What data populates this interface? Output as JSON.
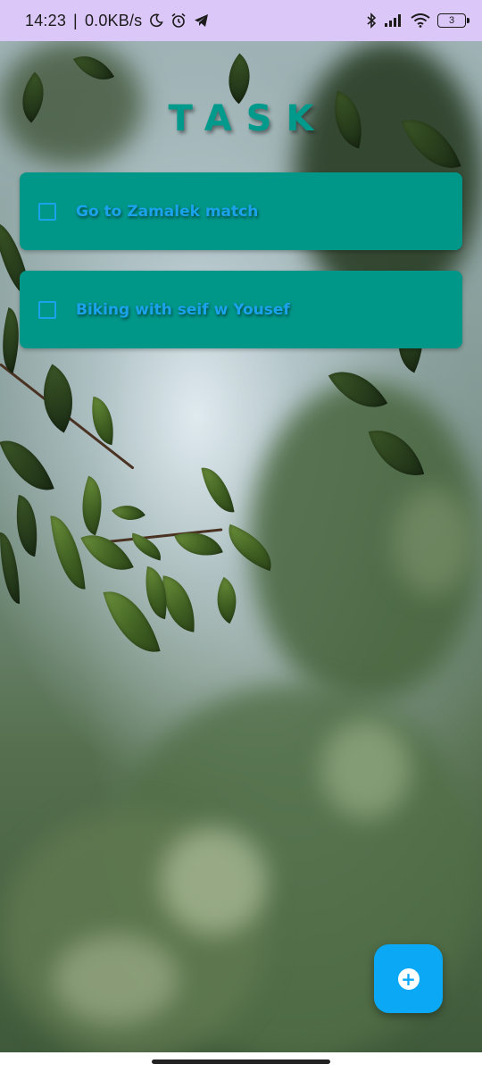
{
  "status_bar": {
    "time": "14:23",
    "separator": "|",
    "network_speed": "0.0KB/s",
    "battery_level": "3",
    "icons": [
      "moon-icon",
      "alarm-icon",
      "telegram-icon",
      "bluetooth-icon",
      "signal-icon",
      "wifi-icon",
      "battery-icon"
    ]
  },
  "app": {
    "title": "TASK",
    "accent_color": "#009688",
    "text_color": "#1aa2ea",
    "fab_color": "#0aa8f5"
  },
  "tasks": [
    {
      "label": "Go to Zamalek match",
      "checked": false
    },
    {
      "label": "Biking with seif w Yousef",
      "checked": false
    }
  ],
  "fab": {
    "icon": "add-circle-icon",
    "glyph": "+"
  }
}
